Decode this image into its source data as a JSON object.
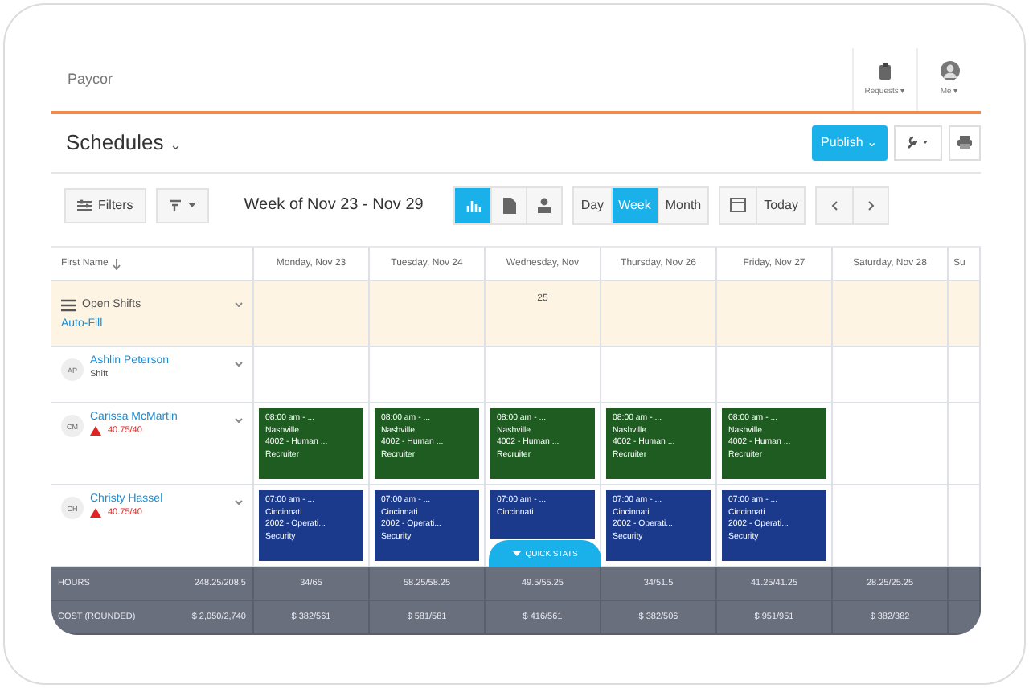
{
  "app": {
    "brand": "Paycor",
    "header_actions": [
      {
        "kind": "requests",
        "label": "Requests",
        "caret": "▾"
      },
      {
        "kind": "me",
        "label": "Me",
        "caret": "▾"
      }
    ]
  },
  "page": {
    "title": "Schedules",
    "caret": "⌄",
    "publish": "Publish",
    "publish_caret": "⌄"
  },
  "toolbar": {
    "filters": "Filters",
    "week": "Week of Nov 23 - Nov 29",
    "views": [
      {
        "kind": "chart",
        "selected": true
      },
      {
        "kind": "document",
        "selected": false
      },
      {
        "kind": "person",
        "selected": false
      }
    ],
    "ranges": [
      {
        "label": "Day",
        "selected": false
      },
      {
        "label": "Week",
        "selected": true
      },
      {
        "label": "Month",
        "selected": false
      }
    ],
    "today": "Today"
  },
  "grid": {
    "name_column": "First Name",
    "days": [
      "Monday, Nov 23",
      "Tuesday, Nov 24",
      "Wednesday, Nov",
      "Thursday, Nov 26",
      "Friday, Nov 27",
      "Saturday, Nov 28",
      "Su"
    ],
    "open_shifts": {
      "label": "Open Shifts",
      "action": "Auto-Fill",
      "cells": [
        {
          "kind": "empty"
        },
        {
          "kind": "empty"
        },
        {
          "kind": "count",
          "text": "25"
        },
        {
          "kind": "empty"
        },
        {
          "kind": "empty"
        },
        {
          "kind": "empty"
        },
        {
          "kind": "empty"
        }
      ]
    },
    "employees": [
      {
        "initials": "AP",
        "name": "Ashlin Peterson",
        "note": "Shift",
        "warning": false,
        "cells": [
          {
            "kind": "empty"
          },
          {
            "kind": "empty"
          },
          {
            "kind": "empty"
          },
          {
            "kind": "empty"
          },
          {
            "kind": "empty"
          },
          {
            "kind": "empty"
          },
          {
            "kind": "empty"
          }
        ]
      },
      {
        "initials": "CM",
        "name": "Carissa McMartin",
        "note": "40.75/40",
        "warning": true,
        "cells": [
          {
            "kind": "shift",
            "color": "#1e5c22",
            "lines": [
              "08:00 am - ...",
              "Nashville",
              "4002 - Human ...",
              "Recruiter"
            ]
          },
          {
            "kind": "shift",
            "color": "#1e5c22",
            "lines": [
              "08:00 am - ...",
              "Nashville",
              "4002 - Human ...",
              "Recruiter"
            ]
          },
          {
            "kind": "shift",
            "color": "#1e5c22",
            "lines": [
              "08:00 am - ...",
              "Nashville",
              "4002 - Human ...",
              "Recruiter"
            ]
          },
          {
            "kind": "shift",
            "color": "#1e5c22",
            "lines": [
              "08:00 am - ...",
              "Nashville",
              "4002 - Human ...",
              "Recruiter"
            ]
          },
          {
            "kind": "shift",
            "color": "#1e5c22",
            "lines": [
              "08:00 am - ...",
              "Nashville",
              "4002 - Human ...",
              "Recruiter"
            ]
          },
          {
            "kind": "empty"
          },
          {
            "kind": "empty"
          }
        ]
      },
      {
        "initials": "CH",
        "name": "Christy Hassel",
        "note": "40.75/40",
        "warning": true,
        "cells": [
          {
            "kind": "shift",
            "color": "#1c3a8c",
            "lines": [
              "07:00 am - ...",
              "Cincinnati",
              "2002 - Operati...",
              "Security"
            ]
          },
          {
            "kind": "shift",
            "color": "#1c3a8c",
            "lines": [
              "07:00 am - ...",
              "Cincinnati",
              "2002 - Operati...",
              "Security"
            ]
          },
          {
            "kind": "shift",
            "color": "#1c3a8c",
            "lines": [
              "07:00 am - ...",
              "Cincinnati"
            ]
          },
          {
            "kind": "shift",
            "color": "#1c3a8c",
            "lines": [
              "07:00 am - ...",
              "Cincinnati",
              "2002 - Operati...",
              "Security"
            ]
          },
          {
            "kind": "shift",
            "color": "#1c3a8c",
            "lines": [
              "07:00 am - ...",
              "Cincinnati",
              "2002 - Operati...",
              "Security"
            ]
          },
          {
            "kind": "empty"
          },
          {
            "kind": "empty"
          }
        ]
      }
    ],
    "quick_stats": "QUICK STATS",
    "totals": [
      {
        "label": "HOURS",
        "total": "248.25/208.5",
        "values": [
          "34/65",
          "58.25/58.25",
          "49.5/55.25",
          "34/51.5",
          "41.25/41.25",
          "28.25/25.25"
        ]
      },
      {
        "label": "COST (ROUNDED)",
        "total": "$ 2,050/2,740",
        "values": [
          "$ 382/561",
          "$ 581/581",
          "$ 416/561",
          "$ 382/506",
          "$ 951/951",
          "$ 382/382"
        ]
      }
    ]
  }
}
